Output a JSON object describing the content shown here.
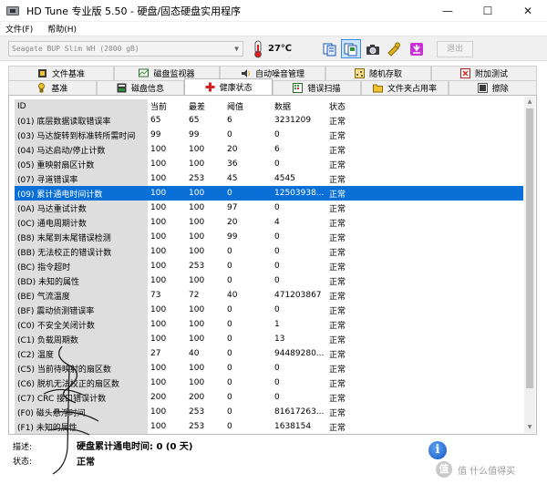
{
  "window": {
    "title": "HD Tune 专业版 5.50 - 硬盘/固态硬盘实用程序",
    "minimize": "—",
    "maximize": "☐",
    "close": "✕"
  },
  "menu": {
    "items": [
      "文件(F)",
      "帮助(H)"
    ]
  },
  "toolbar": {
    "drive": "Seagate BUP Slim WH (2000 gB)",
    "temperature": "27℃",
    "exit_label": "退出",
    "buttons": [
      "copy-info-icon",
      "copy-screenshot-icon",
      "camera-icon",
      "options-icon",
      "save-icon"
    ]
  },
  "tabs": {
    "row1": [
      {
        "label": "文件基准",
        "icon": "file-benchmark-icon"
      },
      {
        "label": "磁盘监视器",
        "icon": "disk-monitor-icon"
      },
      {
        "label": "自动噪音管理",
        "icon": "speaker-icon"
      },
      {
        "label": "随机存取",
        "icon": "random-access-icon"
      },
      {
        "label": "附加测试",
        "icon": "extra-tests-icon"
      }
    ],
    "row2": [
      {
        "label": "基准",
        "icon": "benchmark-icon"
      },
      {
        "label": "磁盘信息",
        "icon": "disk-info-icon"
      },
      {
        "label": "健康状态",
        "icon": "health-icon",
        "active": true
      },
      {
        "label": "错误扫描",
        "icon": "error-scan-icon"
      },
      {
        "label": "文件夹占用率",
        "icon": "folder-usage-icon"
      },
      {
        "label": "擦除",
        "icon": "erase-icon"
      }
    ]
  },
  "table": {
    "columns": [
      "ID",
      "当前",
      "最差",
      "阈值",
      "数据",
      "状态"
    ],
    "selected_index": 6,
    "rows": [
      [
        "(01) 底层数据读取错误率",
        "65",
        "65",
        "6",
        "3231209",
        "正常"
      ],
      [
        "(03) 马达旋转到标准转所需时间",
        "99",
        "99",
        "0",
        "0",
        "正常"
      ],
      [
        "(04) 马达启动/停止计数",
        "100",
        "100",
        "20",
        "6",
        "正常"
      ],
      [
        "(05) 重映射扇区计数",
        "100",
        "100",
        "36",
        "0",
        "正常"
      ],
      [
        "(07) 寻道错误率",
        "100",
        "253",
        "45",
        "4545",
        "正常"
      ],
      [
        "(09) 累计通电时间计数",
        "100",
        "100",
        "0",
        "12503938...",
        "正常"
      ],
      [
        "(0A) 马达重试计数",
        "100",
        "100",
        "97",
        "0",
        "正常"
      ],
      [
        "(0C) 通电周期计数",
        "100",
        "100",
        "20",
        "4",
        "正常"
      ],
      [
        "(B8) 末尾到末尾错误检测",
        "100",
        "100",
        "99",
        "0",
        "正常"
      ],
      [
        "(BB) 无法校正的错误计数",
        "100",
        "100",
        "0",
        "0",
        "正常"
      ],
      [
        "(BC) 指令超时",
        "100",
        "253",
        "0",
        "0",
        "正常"
      ],
      [
        "(BD) 未知的属性",
        "100",
        "100",
        "0",
        "0",
        "正常"
      ],
      [
        "(BE) 气流温度",
        "73",
        "72",
        "40",
        "471203867",
        "正常"
      ],
      [
        "(BF) 震动侦测错误率",
        "100",
        "100",
        "0",
        "0",
        "正常"
      ],
      [
        "(C0) 不安全关闭计数",
        "100",
        "100",
        "0",
        "1",
        "正常"
      ],
      [
        "(C1) 负载周期数",
        "100",
        "100",
        "0",
        "13",
        "正常"
      ],
      [
        "(C2) 温度",
        "27",
        "40",
        "0",
        "94489280...",
        "正常"
      ],
      [
        "(C5) 当前待映射的扇区数",
        "100",
        "100",
        "0",
        "0",
        "正常"
      ],
      [
        "(C6) 脱机无法校正的扇区数",
        "100",
        "100",
        "0",
        "0",
        "正常"
      ],
      [
        "(C7) CRC 接口错误计数",
        "200",
        "200",
        "0",
        "0",
        "正常"
      ],
      [
        "(F0) 磁头悬浮时间",
        "100",
        "253",
        "0",
        "81617263...",
        "正常"
      ],
      [
        "(F1) 未知的属性",
        "100",
        "253",
        "0",
        "1638154",
        "正常"
      ]
    ]
  },
  "bottom": {
    "desc_label": "描述:",
    "desc_value": "硬盘累计通电时间: 0 (0 天)",
    "status_label": "状态:",
    "status_value": "正常",
    "info_glyph": "i"
  },
  "watermark": {
    "text": "值 什么值得买",
    "logo": "值"
  }
}
